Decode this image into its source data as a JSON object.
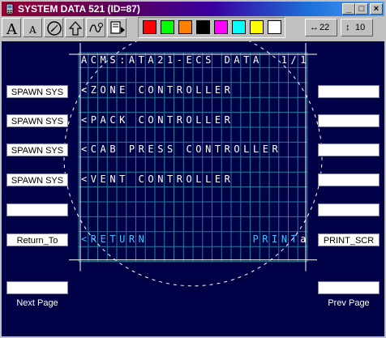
{
  "window": {
    "title": "SYSTEM DATA 521 (ID=87)",
    "minimize": "_",
    "maximize": "□",
    "close": "×"
  },
  "toolbar": {
    "tools": [
      "font-large-icon",
      "font-small-icon",
      "clock-icon",
      "arrow-up-icon",
      "curve-icon",
      "export-icon"
    ],
    "colors": [
      "#ff0000",
      "#00ff00",
      "#ff8000",
      "#000000",
      "#ff00ff",
      "#00ffff",
      "#ffff00",
      "#ffffff"
    ],
    "width_spin": {
      "arrow": "↔",
      "value": "22"
    },
    "height_spin": {
      "arrow": "↕",
      "value": "10"
    }
  },
  "mcdu": {
    "title": "ACMS:ATA21-ECS DATA",
    "page": "1/1",
    "lines": [
      "<ZONE CONTROLLER",
      "<PACK CONTROLLER",
      "<CAB PRESS CONTROLLER",
      "<VENT CONTROLLER"
    ],
    "return": "<RETURN",
    "print": "PRINT",
    "print_suffix": "a",
    "text_color": "#ffffff",
    "highlight_color": "#40c0ff",
    "grid_color": "#1f7fa0"
  },
  "left_buttons": [
    "SPAWN SYS",
    "SPAWN SYS",
    "SPAWN SYS",
    "SPAWN SYS",
    "",
    "Return_To",
    ""
  ],
  "right_buttons": [
    "",
    "",
    "",
    "",
    "",
    "PRINT_SCR",
    ""
  ],
  "footer": {
    "next_page": "Next Page",
    "prev_page": "Prev Page"
  }
}
